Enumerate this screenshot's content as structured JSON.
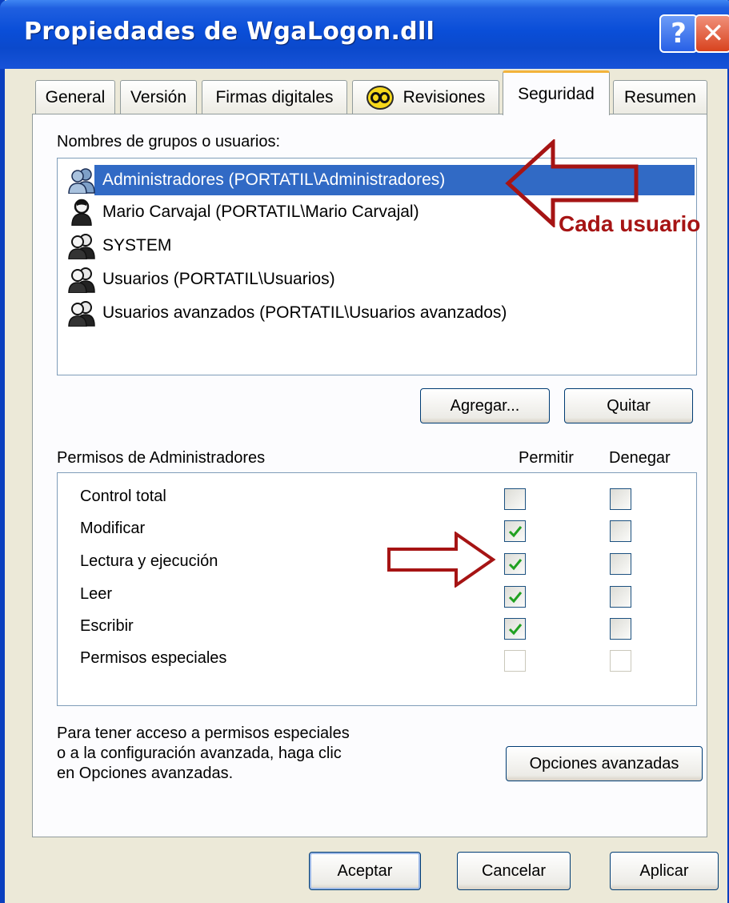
{
  "window": {
    "title": "Propiedades de WgaLogon.dll",
    "help_label": "?",
    "close_label": "✕"
  },
  "tabs": [
    {
      "label": "General",
      "active": false
    },
    {
      "label": "Versión",
      "active": false
    },
    {
      "label": "Firmas digitales",
      "active": false
    },
    {
      "label": "Revisiones",
      "active": false,
      "icon": "revisions-icon"
    },
    {
      "label": "Seguridad",
      "active": true
    },
    {
      "label": "Resumen",
      "active": false
    }
  ],
  "security": {
    "groups_label": "Nombres de grupos o usuarios:",
    "users": [
      {
        "name": "Administradores (PORTATIL\\Administradores)",
        "icon": "users-group-icon",
        "selected": true
      },
      {
        "name": "Mario Carvajal (PORTATIL\\Mario Carvajal)",
        "icon": "user-icon",
        "selected": false
      },
      {
        "name": "SYSTEM",
        "icon": "users-group-icon",
        "selected": false
      },
      {
        "name": "Usuarios (PORTATIL\\Usuarios)",
        "icon": "users-group-icon",
        "selected": false
      },
      {
        "name": "Usuarios avanzados (PORTATIL\\Usuarios avanzados)",
        "icon": "users-group-icon",
        "selected": false
      }
    ],
    "add_label": "Agregar...",
    "remove_label": "Quitar",
    "permissions_label": "Permisos de Administradores",
    "allow_header": "Permitir",
    "deny_header": "Denegar",
    "permissions": [
      {
        "name": "Control total",
        "allow": false,
        "deny": false,
        "disabled": false
      },
      {
        "name": "Modificar",
        "allow": true,
        "deny": false,
        "disabled": false
      },
      {
        "name": "Lectura y ejecución",
        "allow": true,
        "deny": false,
        "disabled": false
      },
      {
        "name": "Leer",
        "allow": true,
        "deny": false,
        "disabled": false
      },
      {
        "name": "Escribir",
        "allow": true,
        "deny": false,
        "disabled": false
      },
      {
        "name": "Permisos especiales",
        "allow": false,
        "deny": false,
        "disabled": true
      }
    ],
    "advanced_note_line1": "Para tener acceso a permisos especiales",
    "advanced_note_line2": "o a la configuración avanzada, haga clic",
    "advanced_note_line3": "en Opciones avanzadas.",
    "advanced_button": "Opciones avanzadas"
  },
  "footer": {
    "ok_label": "Aceptar",
    "cancel_label": "Cancelar",
    "apply_label": "Aplicar"
  },
  "annotation": {
    "text": "Cada usuario",
    "color": "#a61414"
  },
  "colors": {
    "titlebar": "#0a4ed8",
    "selection": "#316ac5",
    "active_tab_accent": "#f3b33b",
    "dialog_bg": "#ece9d8"
  }
}
